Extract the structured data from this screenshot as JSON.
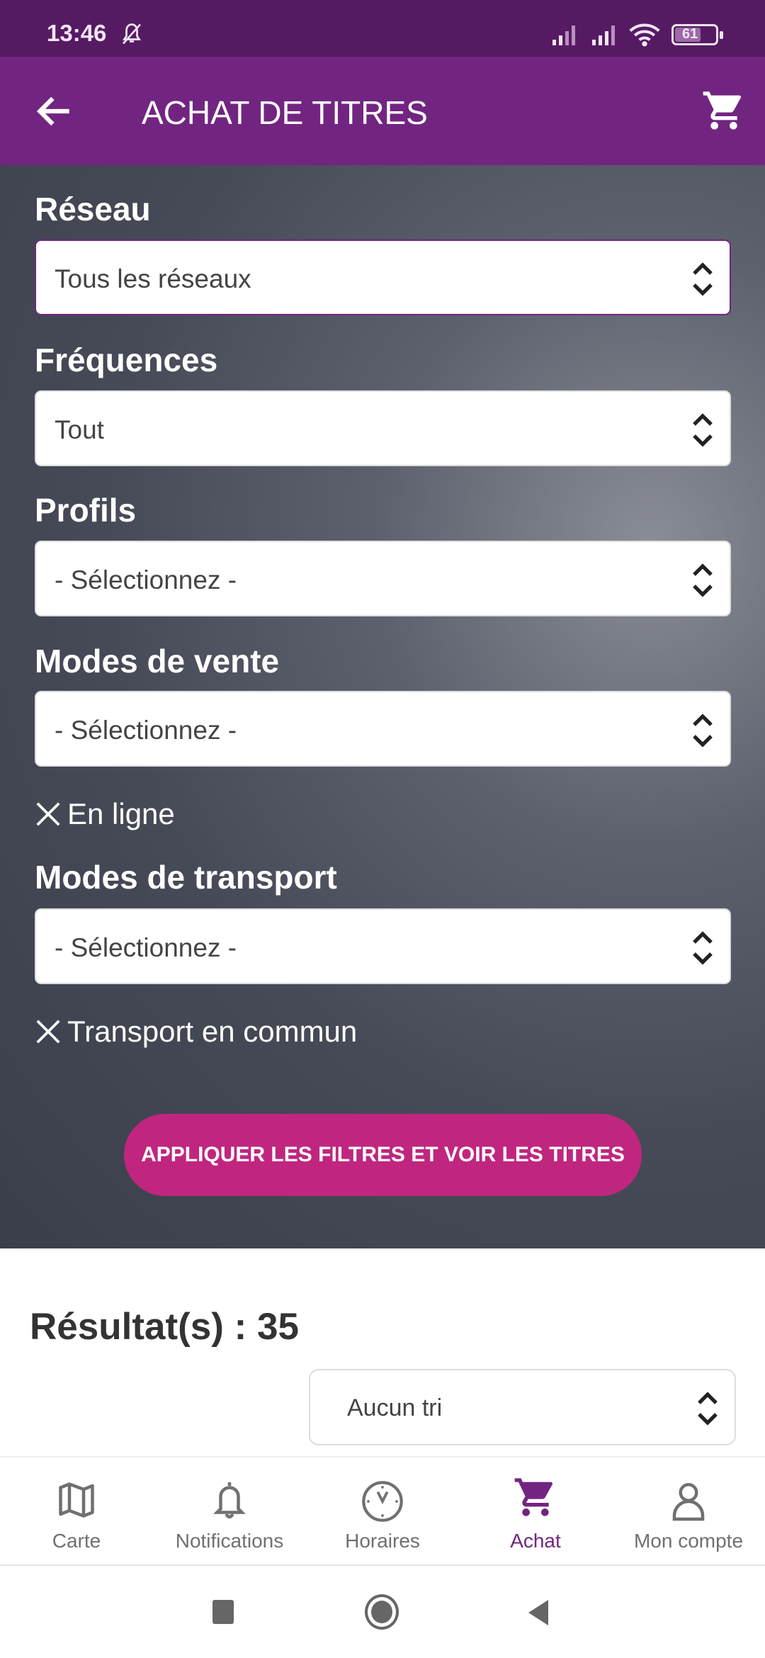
{
  "status_bar": {
    "time": "13:46",
    "battery": "61"
  },
  "app_bar": {
    "title": "ACHAT DE TITRES"
  },
  "filters": {
    "reseau": {
      "label": "Réseau",
      "value": "Tous les réseaux"
    },
    "frequences": {
      "label": "Fréquences",
      "value": "Tout"
    },
    "profils": {
      "label": "Profils",
      "value": "- Sélectionnez -"
    },
    "modes_vente": {
      "label": "Modes de vente",
      "value": "- Sélectionnez -",
      "chip": "En ligne"
    },
    "modes_transport": {
      "label": "Modes de transport",
      "value": "- Sélectionnez -",
      "chip": "Transport en commun"
    },
    "apply_label": "APPLIQUER LES FILTRES ET VOIR LES TITRES"
  },
  "results": {
    "label": "Résultat(s) : 35",
    "sort_value": "Aucun tri"
  },
  "bottom_nav": [
    {
      "label": "Carte",
      "icon": "map-icon"
    },
    {
      "label": "Notifications",
      "icon": "bell-icon"
    },
    {
      "label": "Horaires",
      "icon": "clock-icon"
    },
    {
      "label": "Achat",
      "icon": "cart-icon",
      "active": true
    },
    {
      "label": "Mon compte",
      "icon": "user-icon"
    }
  ],
  "colors": {
    "primary": "#722580",
    "status": "#561a63",
    "accent": "#c0267f"
  }
}
